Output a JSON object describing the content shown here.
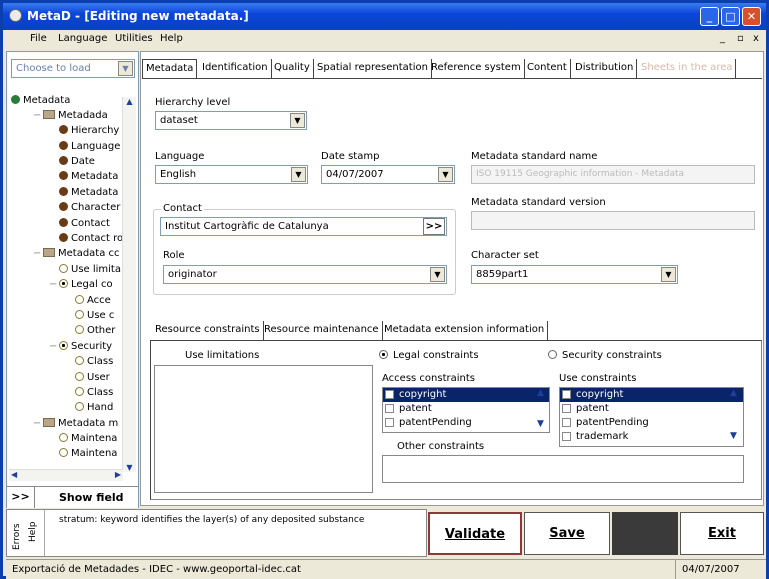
{
  "window": {
    "title": "MetaD - [Editing new metadata.]"
  },
  "menu": [
    "File",
    "Language",
    "Utilities",
    "Help"
  ],
  "mdi_controls": [
    "_",
    "ȧ",
    "x"
  ],
  "left": {
    "choose_placeholder": "Choose to load",
    "tree": [
      {
        "label": "Metadata",
        "icon": "globe-icon",
        "indent": 0
      },
      {
        "label": "Metadada",
        "icon": "folder-icon",
        "indent": 1
      },
      {
        "label": "Hierarchy le",
        "icon": "bullet",
        "indent": 2
      },
      {
        "label": "Language",
        "icon": "bullet",
        "indent": 2
      },
      {
        "label": "Date",
        "icon": "bullet",
        "indent": 2
      },
      {
        "label": "Metadata st.",
        "icon": "bullet",
        "indent": 2
      },
      {
        "label": "Metadata st.",
        "icon": "bullet",
        "indent": 2
      },
      {
        "label": "Character se",
        "icon": "bullet",
        "indent": 2
      },
      {
        "label": "Contact",
        "icon": "bullet",
        "indent": 2
      },
      {
        "label": "Contact role",
        "icon": "bullet",
        "indent": 2
      },
      {
        "label": "Metadata cc",
        "icon": "folder-icon",
        "indent": 1
      },
      {
        "label": "Use limita",
        "icon": "circle",
        "indent": 2
      },
      {
        "label": "Legal co",
        "icon": "radio",
        "indent": 2
      },
      {
        "label": "Acce",
        "icon": "circle",
        "indent": 3
      },
      {
        "label": "Use c",
        "icon": "circle",
        "indent": 3
      },
      {
        "label": "Other",
        "icon": "circle",
        "indent": 3
      },
      {
        "label": "Security",
        "icon": "radio",
        "indent": 2
      },
      {
        "label": "Class",
        "icon": "circle",
        "indent": 3
      },
      {
        "label": "User",
        "icon": "circle",
        "indent": 3
      },
      {
        "label": "Class",
        "icon": "circle",
        "indent": 3
      },
      {
        "label": "Hand",
        "icon": "circle",
        "indent": 3
      },
      {
        "label": "Metadata m",
        "icon": "folder-icon",
        "indent": 1
      },
      {
        "label": "Maintena",
        "icon": "circle",
        "indent": 2
      },
      {
        "label": "Maintena",
        "icon": "circle",
        "indent": 2
      }
    ],
    "expand_label": ">>",
    "show_field_label": "Show field"
  },
  "tabs": [
    "Metadata",
    "Identification",
    "Quality",
    "Spatial representation",
    "Reference system",
    "Content",
    "Distribution",
    "Sheets in the area"
  ],
  "form": {
    "hierarchy_label": "Hierarchy level",
    "hierarchy_value": "dataset",
    "language_label": "Language",
    "language_value": "English",
    "date_label": "Date stamp",
    "date_value": "04/07/2007",
    "std_name_label": "Metadata standard name",
    "std_name_value": "ISO 19115 Geographic information - Metadata",
    "std_version_label": "Metadata standard version",
    "std_version_value": "",
    "contact_label": "Contact",
    "contact_value": "Institut Cartogràfic de Catalunya",
    "contact_btn": ">>",
    "role_label": "Role",
    "role_value": "originator",
    "charset_label": "Character set",
    "charset_value": "8859part1"
  },
  "subtabs": [
    "Resource constraints",
    "Resource maintenance",
    "Metadata extension information"
  ],
  "constraints": {
    "use_limitations_label": "Use limitations",
    "legal_radio": "Legal constraints",
    "security_radio": "Security constraints",
    "access_label": "Access constraints",
    "access_items": [
      "copyright",
      "patent",
      "patentPending"
    ],
    "use_label": "Use constraints",
    "use_items": [
      "copyright",
      "patent",
      "patentPending",
      "trademark"
    ],
    "other_label": "Other constraints"
  },
  "bottom": {
    "errors_label": "Errors",
    "help_label": "Help",
    "help_text": "stratum: keyword identifies the layer(s) of any deposited substance",
    "validate": "Validate",
    "save": "Save",
    "exit": "Exit"
  },
  "status": {
    "left": "Exportació de Metadades - IDEC - www.geoportal-idec.cat",
    "right": "04/07/2007"
  }
}
